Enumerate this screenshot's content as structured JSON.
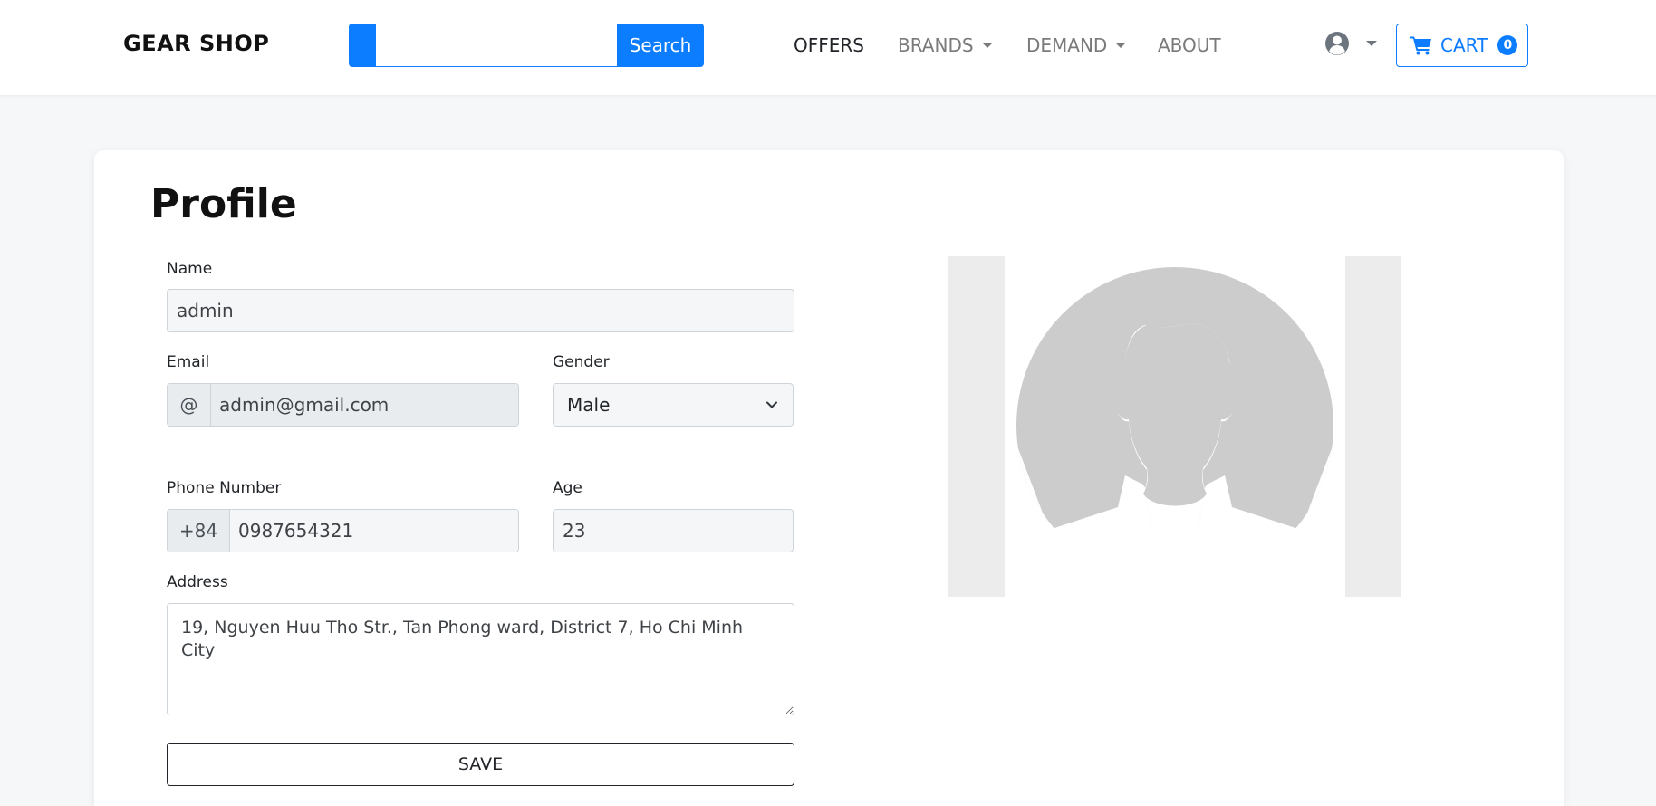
{
  "header": {
    "brand": "GEAR SHOP",
    "search": {
      "value": "",
      "placeholder": "",
      "button_label": "Search"
    },
    "nav": [
      {
        "label": "OFFERS",
        "active": true,
        "dropdown": false
      },
      {
        "label": "BRANDS",
        "active": false,
        "dropdown": true
      },
      {
        "label": "DEMAND",
        "active": false,
        "dropdown": true
      },
      {
        "label": "ABOUT",
        "active": false,
        "dropdown": false
      }
    ],
    "user_icon": "user-circle-icon",
    "cart": {
      "label": "CART",
      "count": "0",
      "icon": "shopping-cart-icon"
    }
  },
  "profile": {
    "title": "Profile",
    "name": {
      "label": "Name",
      "value": "admin"
    },
    "email": {
      "label": "Email",
      "prefix": "@",
      "value": "admin@gmail.com"
    },
    "gender": {
      "label": "Gender",
      "value": "Male"
    },
    "phone": {
      "label": "Phone Number",
      "prefix": "+84",
      "value": "0987654321"
    },
    "age": {
      "label": "Age",
      "value": "23"
    },
    "address": {
      "label": "Address",
      "value": "19, Nguyen Huu Tho Str., Tan Phong ward, District 7, Ho Chi Minh City"
    },
    "save_label": "SAVE",
    "avatar_icon": "default-avatar-icon"
  },
  "colors": {
    "primary": "#0d7dff",
    "page_background": "#f6f7f9",
    "avatar_gray": "#cccccc",
    "avatar_side_panel": "#ececec"
  }
}
